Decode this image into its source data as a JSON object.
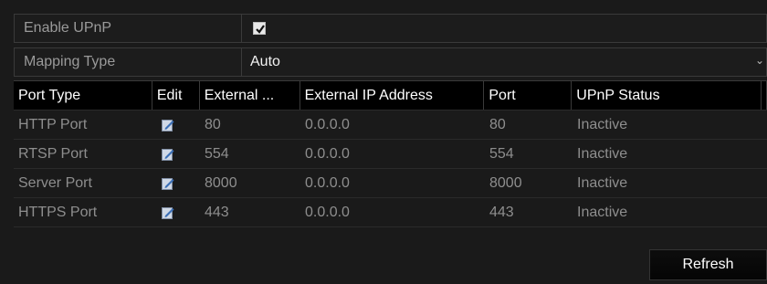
{
  "upnp": {
    "label": "Enable UPnP",
    "checked": true
  },
  "mapping": {
    "label": "Mapping Type",
    "value": "Auto"
  },
  "table": {
    "headers": [
      "Port Type",
      "Edit",
      "External ...",
      "External IP Address",
      "Port",
      "UPnP Status"
    ],
    "rows": [
      {
        "port_type": "HTTP Port",
        "external": "80",
        "external_ip": "0.0.0.0",
        "port": "80",
        "status": "Inactive"
      },
      {
        "port_type": "RTSP Port",
        "external": "554",
        "external_ip": "0.0.0.0",
        "port": "554",
        "status": "Inactive"
      },
      {
        "port_type": "Server Port",
        "external": "8000",
        "external_ip": "0.0.0.0",
        "port": "8000",
        "status": "Inactive"
      },
      {
        "port_type": "HTTPS Port",
        "external": "443",
        "external_ip": "0.0.0.0",
        "port": "443",
        "status": "Inactive"
      }
    ]
  },
  "actions": {
    "refresh_label": "Refresh"
  },
  "icons": {
    "edit": "edit-icon",
    "check": "checkmark-icon",
    "dropdown": "chevron-down-icon"
  }
}
